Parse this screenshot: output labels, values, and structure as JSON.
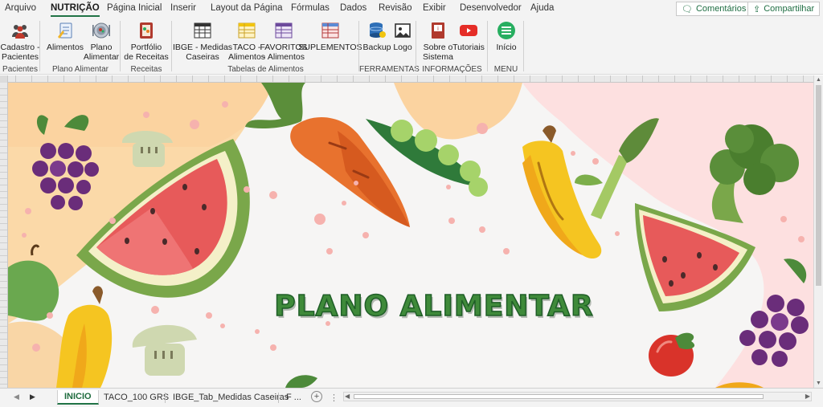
{
  "ribbon_tabs": [
    "Arquivo",
    "NUTRIÇÃO",
    "Página Inicial",
    "Inserir",
    "Layout da Página",
    "Fórmulas",
    "Dados",
    "Revisão",
    "Exibir",
    "Desenvolvedor",
    "Ajuda"
  ],
  "active_tab": "NUTRIÇÃO",
  "top_buttons": {
    "comments": "Comentários",
    "share": "Compartilhar"
  },
  "groups": {
    "pacientes": {
      "label": "Pacientes",
      "btn1_l1": "Cadastro -",
      "btn1_l2": "Pacientes"
    },
    "plano": {
      "label": "Plano Alimentar",
      "btn1": "Alimentos",
      "btn2_l1": "Plano",
      "btn2_l2": "Alimentar"
    },
    "receitas": {
      "label": "Receitas",
      "btn1_l1": "Portfólio",
      "btn1_l2": "de Receitas"
    },
    "tabelas": {
      "label": "Tabelas de Alimentos",
      "btn1_l1": "IBGE - Medidas",
      "btn1_l2": "Caseiras",
      "btn2_l1": "TACO -",
      "btn2_l2": "Alimentos",
      "btn3_l1": "FAVORITOS",
      "btn3_l2": "- Alimentos",
      "btn4": "SUPLEMENTOS"
    },
    "ferramentas": {
      "label": "FERRAMENTAS",
      "btn1": "Backup",
      "btn2": "Logo"
    },
    "informacoes": {
      "label": "INFORMAÇÕES",
      "btn1_l1": "Sobre o",
      "btn1_l2": "Sistema",
      "btn2": "Tutoriais"
    },
    "menu": {
      "label": "MENU",
      "btn1": "Início"
    }
  },
  "canvas": {
    "title": "PLANO ALIMENTAR"
  },
  "sheet_tabs": [
    "INICIO",
    "TACO_100 GRS",
    "IBGE_Tab_Medidas Caseiras",
    "F ..."
  ],
  "colors": {
    "excel_green": "#217346",
    "title_green": "#3f8a3a",
    "title_stroke": "#1f5e27"
  }
}
